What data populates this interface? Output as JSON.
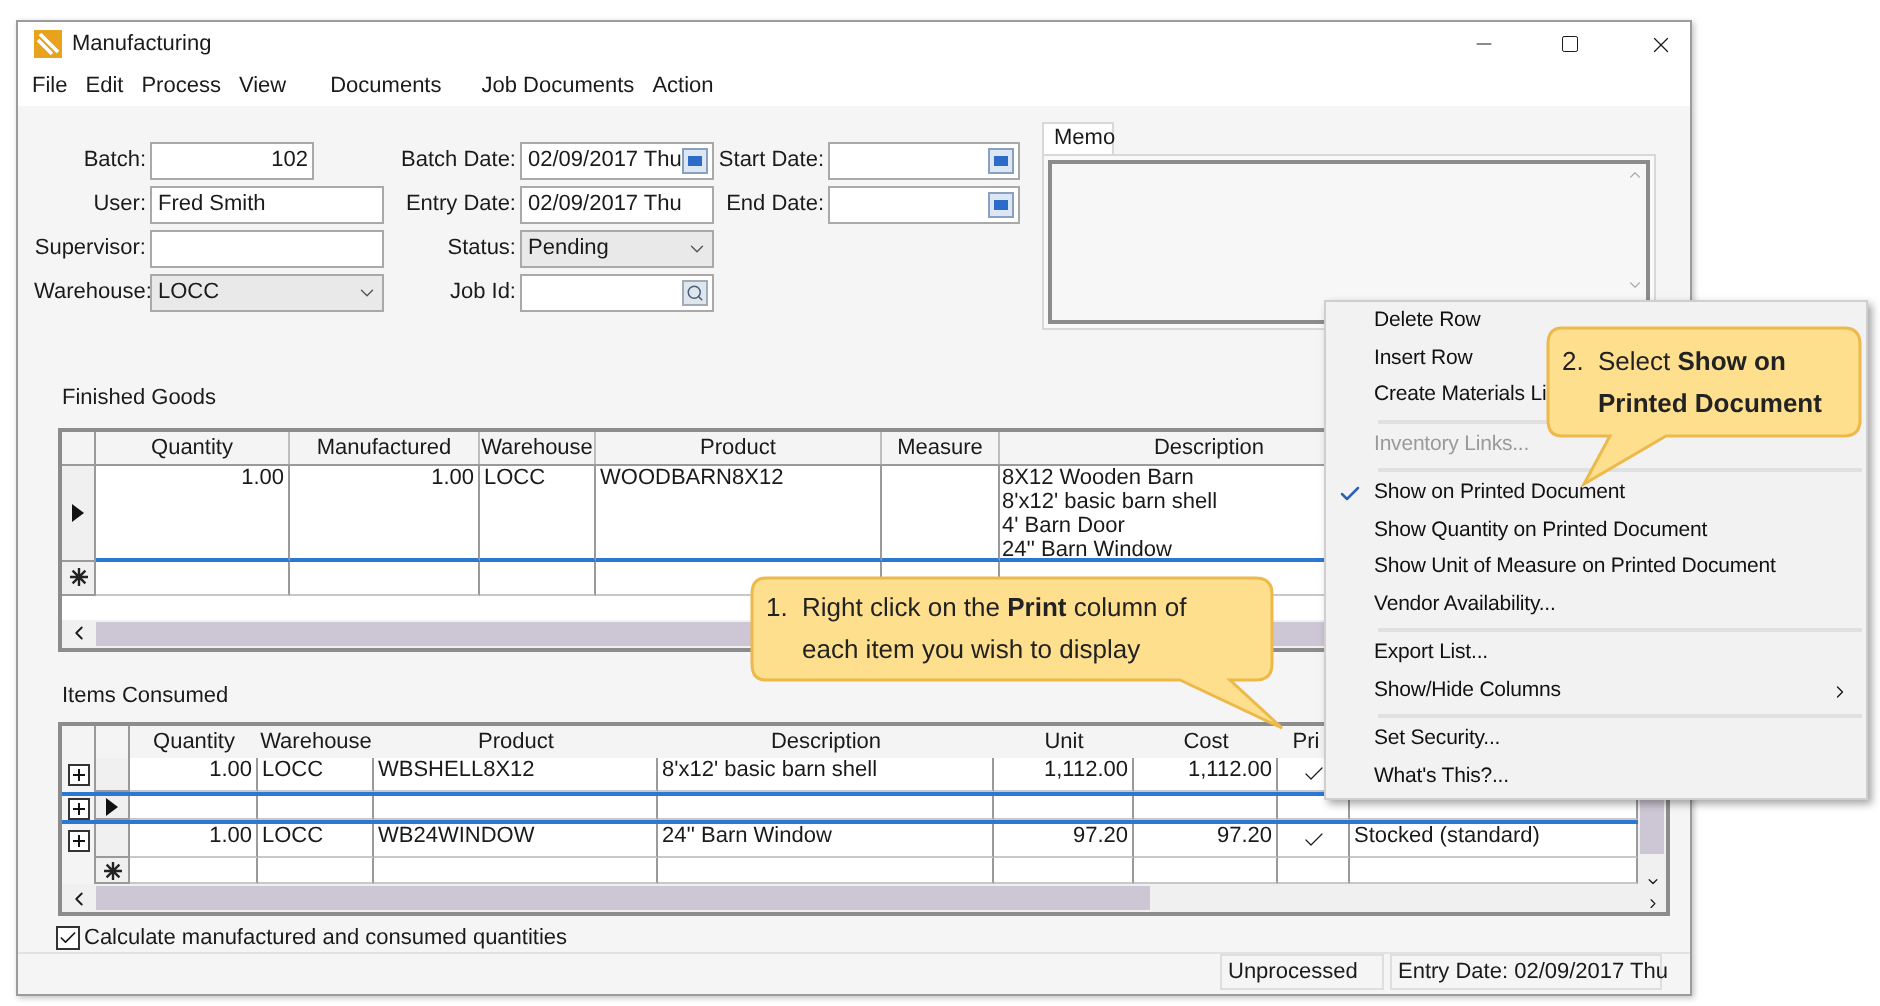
{
  "window": {
    "title": "Manufacturing"
  },
  "menu_bar": [
    {
      "label": "File"
    },
    {
      "label": "Edit"
    },
    {
      "label": "Process"
    },
    {
      "label": "View"
    },
    {
      "label": "Documents"
    },
    {
      "label": "Job Documents"
    },
    {
      "label": "Action"
    }
  ],
  "form": {
    "columns": [
      [
        {
          "label": "Batch:",
          "value": "102",
          "kind": "number"
        },
        {
          "label": "User:",
          "value": "Fred Smith",
          "kind": "text"
        },
        {
          "label": "Supervisor:",
          "kind": "text"
        },
        {
          "label": "Warehouse:",
          "value": "LOCC",
          "kind": "dropdown"
        }
      ],
      [
        {
          "label": "Batch Date:",
          "value": "02/09/2017 Thu",
          "kind": "date"
        },
        {
          "label": "Entry Date:",
          "value": "02/09/2017 Thu",
          "kind": "text"
        },
        {
          "label": "Status:",
          "value": "Pending",
          "kind": "dropdown"
        },
        {
          "label": "Job Id:",
          "kind": "lookup"
        }
      ],
      [
        {
          "label": "Start Date:",
          "kind": "date"
        },
        {
          "label": "End Date:",
          "kind": "date"
        }
      ]
    ]
  },
  "memo": {
    "tab": "Memo"
  },
  "finished_goods": {
    "title": "Finished Goods",
    "columns": [
      "Quantity",
      "Manufactured",
      "Warehouse",
      "Product",
      "Measure",
      "Description"
    ],
    "rows": [
      {
        "kind": "data",
        "current": true,
        "quantity": "1.00",
        "manufactured": "1.00",
        "warehouse": "LOCC",
        "product": "WOODBARN8X12",
        "description": [
          "8X12 Wooden Barn",
          "8'x12' basic barn shell",
          "4' Barn Door",
          "24'' Barn Window"
        ]
      },
      {
        "kind": "new",
        "current": false
      }
    ]
  },
  "items_consumed": {
    "title": "Items Consumed",
    "columns": [
      "Quantity",
      "Warehouse",
      "Product",
      "Description",
      "Unit",
      "Cost",
      "Pri"
    ],
    "rows": [
      {
        "kind": "data",
        "current": false,
        "quantity": "1.00",
        "warehouse": "LOCC",
        "product": "WBSHELL8X12",
        "description": "8'x12' basic barn shell",
        "unit": "1,112.00",
        "cost": "1,112.00",
        "print": true
      },
      {
        "kind": "data",
        "current": true,
        "print": false
      },
      {
        "kind": "data",
        "current": false,
        "quantity": "1.00",
        "warehouse": "LOCC",
        "product": "WB24WINDOW",
        "description": "24'' Barn Window",
        "unit": "97.20",
        "cost": "97.20",
        "print": true,
        "column_9": "Stocked (standard)"
      },
      {
        "kind": "new",
        "current": false
      }
    ]
  },
  "calculate_checkbox": {
    "label": "Calculate manufactured and consumed quantities",
    "checked": true
  },
  "status_bar": [
    "Unprocessed",
    "Entry Date: 02/09/2017 Thu"
  ],
  "context_menu": [
    {
      "kind": "item",
      "label": "Delete Row",
      "disabled": false,
      "checked": false,
      "submenu": false
    },
    {
      "kind": "item",
      "label": "Insert Row",
      "disabled": false,
      "checked": false
    },
    {
      "kind": "item",
      "label": "Create Materials Li",
      "disabled": false,
      "checked": false
    },
    {
      "kind": "separator"
    },
    {
      "kind": "item",
      "label": "Inventory Links...",
      "disabled": true,
      "checked": false,
      "submenu": false
    },
    {
      "kind": "separator"
    },
    {
      "kind": "item",
      "label": "Show on Printed Document",
      "disabled": false,
      "checked": true,
      "submenu": false
    },
    {
      "kind": "item",
      "label": "Show Quantity on Printed Document",
      "disabled": false,
      "checked": false,
      "submenu": false
    },
    {
      "kind": "item",
      "label": "Show Unit of Measure on Printed Document",
      "disabled": false,
      "checked": false,
      "submenu": false
    },
    {
      "kind": "item",
      "label": "Vendor Availability...",
      "disabled": false,
      "checked": false,
      "submenu": false
    },
    {
      "kind": "separator"
    },
    {
      "kind": "item",
      "label": "Export List...",
      "disabled": false,
      "checked": false,
      "submenu": false
    },
    {
      "kind": "item",
      "label": "Show/Hide Columns",
      "disabled": false,
      "checked": false,
      "submenu": true
    },
    {
      "kind": "separator"
    },
    {
      "kind": "item",
      "label": "Set Security...",
      "disabled": false,
      "checked": false,
      "submenu": false
    },
    {
      "kind": "item",
      "label": "What's This?...",
      "disabled": false,
      "checked": false,
      "submenu": false
    }
  ],
  "callouts": [
    {
      "number": "1.",
      "text": "Right click on the **Print** column of each item you wish to display"
    },
    {
      "number": "2.",
      "text": "Select **Show on Printed Document**"
    }
  ]
}
